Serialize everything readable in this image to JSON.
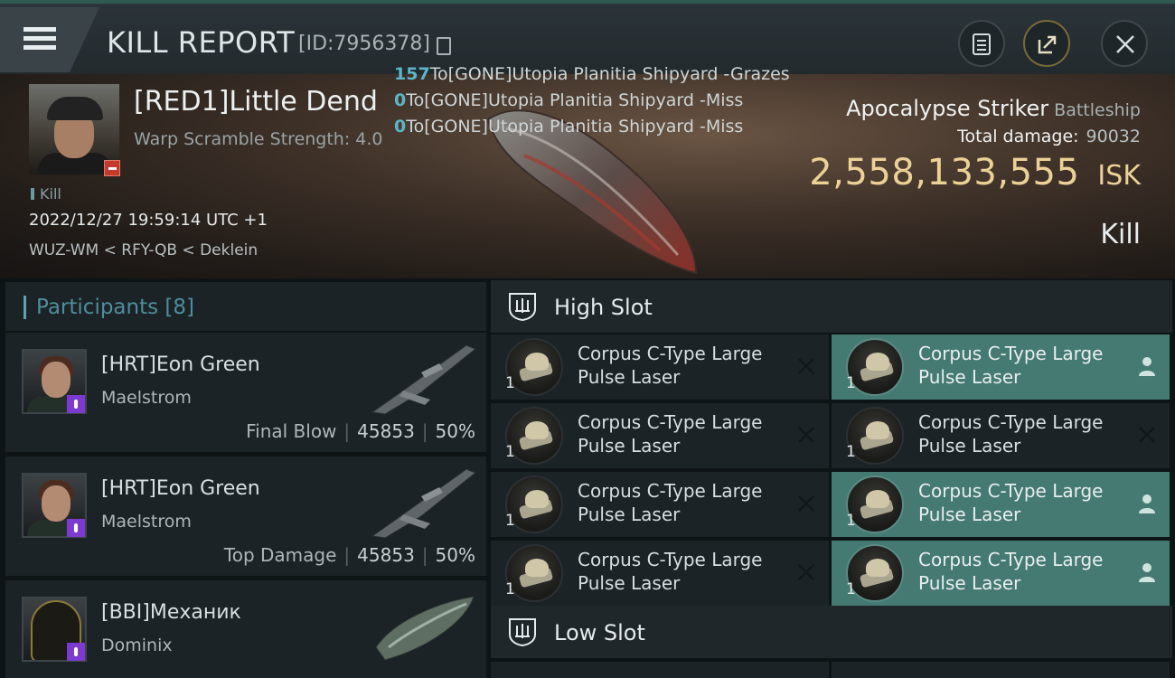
{
  "header": {
    "title": "KILL REPORT",
    "kill_id": "[ID:7956378]",
    "icons": [
      "menu-icon",
      "clipboard-icon",
      "share-icon",
      "close-icon"
    ]
  },
  "victim": {
    "name": "[RED1]Little Dend",
    "scramble": "Warp Scramble Strength: 4.0",
    "tag": "Kill",
    "datetime": "2022/12/27 19:59:14 UTC +1",
    "location": "WUZ-WM < RFY-QB < Deklein"
  },
  "damage_log": [
    {
      "num": "157",
      "text": "To[GONE]Utopia Planitia Shipyard -Grazes"
    },
    {
      "num": "0",
      "text": "To[GONE]Utopia Planitia Shipyard -Miss"
    },
    {
      "num": "0",
      "text": "To[GONE]Utopia Planitia Shipyard -Miss"
    }
  ],
  "ship": {
    "name": "Apocalypse Striker",
    "class": "Battleship",
    "total_damage_label": "Total damage:",
    "total_damage": "90032",
    "isk_value": "2,558,133,555",
    "isk_unit": "ISK",
    "result": "Kill"
  },
  "participants": {
    "title": "Participants",
    "count": "[8]",
    "rows": [
      {
        "name": "[HRT]Eon Green",
        "ship": "Maelstrom",
        "label": "Final Blow",
        "damage": "45853",
        "percent": "50%",
        "sep": "|"
      },
      {
        "name": "[HRT]Eon Green",
        "ship": "Maelstrom",
        "label": "Top Damage",
        "damage": "45853",
        "percent": "50%",
        "sep": "|"
      },
      {
        "name": "[BBI]Механик",
        "ship": "Dominix"
      }
    ]
  },
  "fitting": {
    "high_slot_title": "High Slot",
    "low_slot_title": "Low Slot",
    "modules": [
      {
        "line1": "Corpus C-Type Large",
        "line2": "Pulse Laser",
        "qty": "1",
        "state": "destroyed"
      },
      {
        "line1": "Corpus C-Type Large",
        "line2": "Pulse Laser",
        "qty": "1",
        "state": "dropped"
      },
      {
        "line1": "Corpus C-Type Large",
        "line2": "Pulse Laser",
        "qty": "1",
        "state": "destroyed"
      },
      {
        "line1": "Corpus C-Type Large",
        "line2": "Pulse Laser",
        "qty": "1",
        "state": "destroyed"
      },
      {
        "line1": "Corpus C-Type Large",
        "line2": "Pulse Laser",
        "qty": "1",
        "state": "destroyed"
      },
      {
        "line1": "Corpus C-Type Large",
        "line2": "Pulse Laser",
        "qty": "1",
        "state": "dropped"
      },
      {
        "line1": "Corpus C-Type Large",
        "line2": "Pulse Laser",
        "qty": "1",
        "state": "destroyed"
      },
      {
        "line1": "Corpus C-Type Large",
        "line2": "Pulse Laser",
        "qty": "1",
        "state": "dropped"
      }
    ]
  },
  "colors": {
    "accent_teal": "#457a73",
    "isk_gold": "#ecd197",
    "participants_title": "#4d8e9c",
    "dmg_number": "#5bb5c9"
  }
}
